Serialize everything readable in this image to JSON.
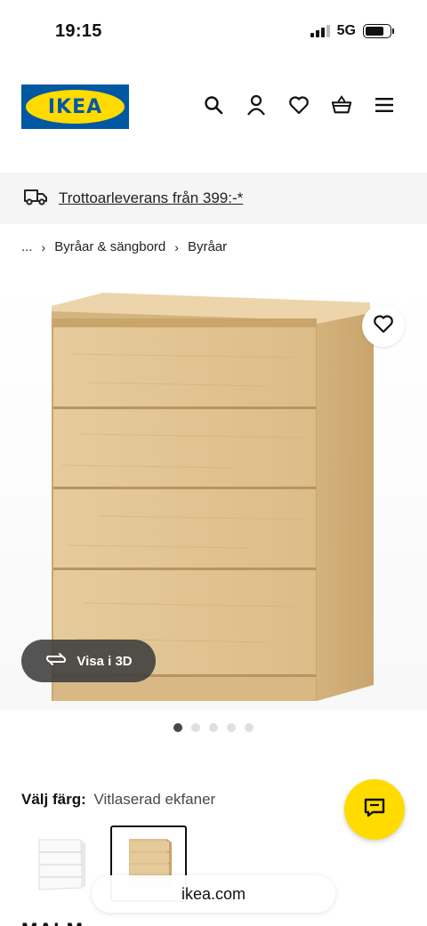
{
  "status_bar": {
    "time": "19:15",
    "network": "5G"
  },
  "header": {
    "logo_text": "IKEA",
    "icons": [
      "search-icon",
      "user-icon",
      "heart-icon",
      "basket-icon",
      "menu-icon"
    ]
  },
  "banner": {
    "icon": "truck-icon",
    "text": "Trottoarleverans från 399:-*"
  },
  "breadcrumb": {
    "ellipsis": "...",
    "items": [
      "Byråar & sängbord",
      "Byråar"
    ]
  },
  "gallery": {
    "view_3d_label": "Visa i 3D",
    "image_count": 5,
    "active_index": 0
  },
  "color_picker": {
    "label": "Välj färg:",
    "value": "Vitlaserad ekfaner",
    "options": [
      {
        "name": "white",
        "color": "#f7f7f7"
      },
      {
        "name": "white-stained-oak-veneer",
        "color": "#e2c595",
        "selected": true
      }
    ]
  },
  "address_bar": {
    "url": "ikea.com"
  },
  "product": {
    "name": "MALM"
  },
  "colors": {
    "brand_blue": "#0058a3",
    "brand_yellow": "#ffdb00",
    "wood": "#e2c595"
  }
}
